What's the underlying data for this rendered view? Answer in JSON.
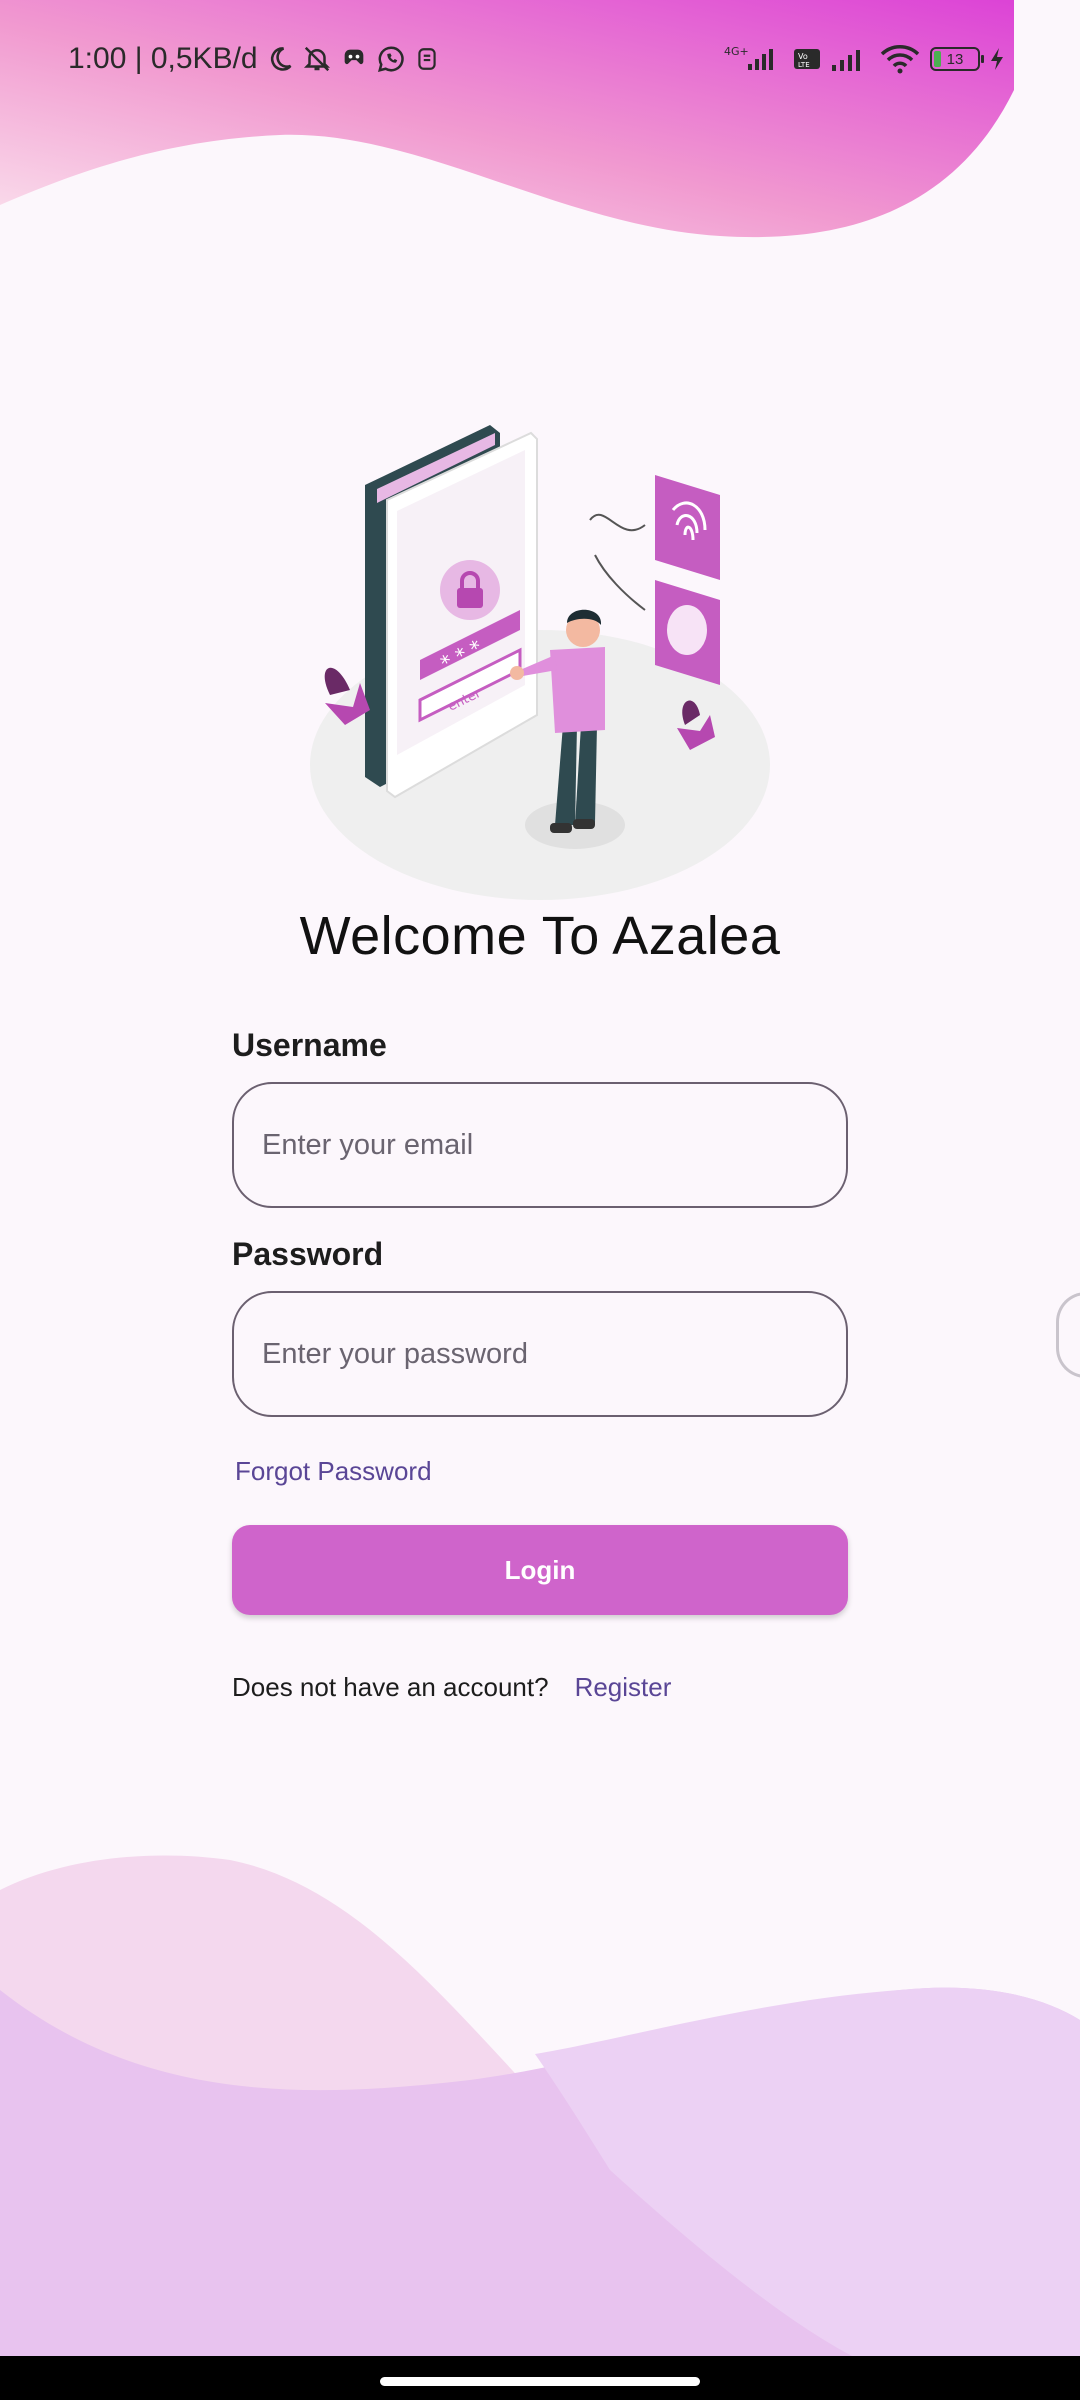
{
  "status_bar": {
    "time_speed": "1:00 | 0,5KB/d",
    "battery_level": "13"
  },
  "main": {
    "title": "Welcome To Azalea",
    "illustration_text": "enter"
  },
  "form": {
    "username": {
      "label": "Username",
      "placeholder": "Enter your email",
      "value": ""
    },
    "password": {
      "label": "Password",
      "placeholder": "Enter your password",
      "value": ""
    },
    "forgot_label": "Forgot Password",
    "login_label": "Login",
    "no_account_text": "Does not have an account?",
    "register_label": "Register"
  },
  "colors": {
    "accent": "#cf64cb",
    "link": "#5a4696",
    "background": "#fcf7fc"
  }
}
